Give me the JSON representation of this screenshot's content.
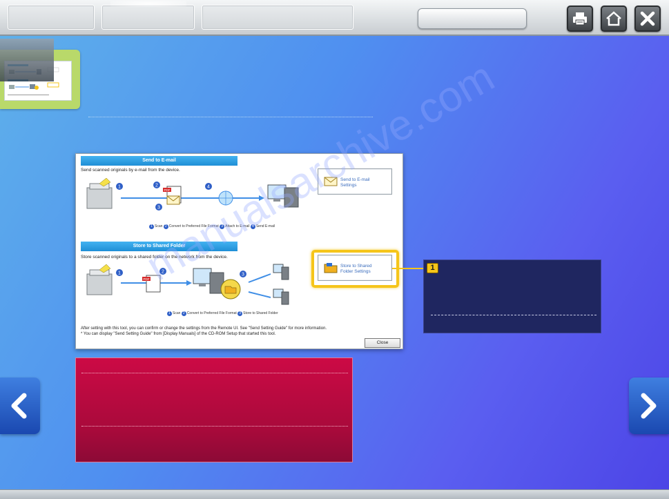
{
  "toolbar": {
    "tabs": [
      "",
      "",
      ""
    ],
    "icons": [
      "print-icon",
      "home-icon",
      "close-icon"
    ]
  },
  "screenshot": {
    "email_section": {
      "heading": "Send to E-mail",
      "description": "Send scanned originals by e-mail from the device.",
      "steps": [
        "Scan",
        "Convert to Preferred File Format",
        "Attach to E-mail",
        "Send E-mail"
      ],
      "settings_button": "Send to E-mail Settings"
    },
    "folder_section": {
      "heading": "Store to Shared Folder",
      "description": "Store scanned originals to a shared folder on the network from the device.",
      "steps": [
        "Scan",
        "Convert to Preferred File Format",
        "Store to Shared Folder"
      ],
      "settings_button": "Store to Shared Folder Settings"
    },
    "note_line1": "After setting with this tool, you can confirm or change the settings from the Remote UI. See \"Send Setting Guide\" for more information.",
    "note_line2": "* You can display \"Send Setting Guide\" from [Display Manuals] of the CD-ROM Setup that started this tool.",
    "close_label": "Close",
    "pdf_label": "PDF",
    "step_numbers": [
      "1",
      "2",
      "3",
      "4"
    ]
  },
  "callout": {
    "number": "1"
  },
  "watermark": "manualsarchive.com",
  "colors": {
    "accent_yellow": "#f5c51a",
    "callout_bg": "#1f2660",
    "info_bg": "#cc0a45",
    "section_header": "#1f8fd6"
  }
}
